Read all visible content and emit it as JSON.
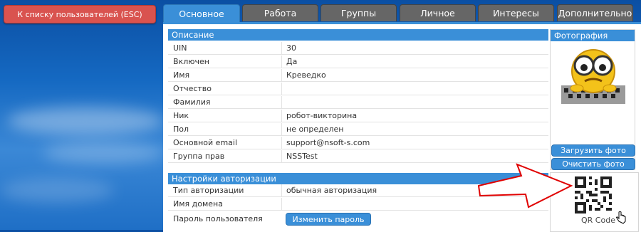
{
  "back_button": {
    "label": "К списку пользователей (ESC)"
  },
  "tabs": [
    {
      "label": "Основное",
      "active": true
    },
    {
      "label": "Работа",
      "active": false
    },
    {
      "label": "Группы",
      "active": false
    },
    {
      "label": "Личное",
      "active": false
    },
    {
      "label": "Интересы",
      "active": false
    },
    {
      "label": "Дополнительно",
      "active": false
    }
  ],
  "description": {
    "header": "Описание",
    "rows": [
      {
        "label": "UIN",
        "value": "30"
      },
      {
        "label": "Включен",
        "value": "Да"
      },
      {
        "label": "Имя",
        "value": "Креведко"
      },
      {
        "label": "Отчество",
        "value": ""
      },
      {
        "label": "Фамилия",
        "value": ""
      },
      {
        "label": "Ник",
        "value": "робот-викторина"
      },
      {
        "label": "Пол",
        "value": "не определен"
      },
      {
        "label": "Основной email",
        "value": "support@nsoft-s.com"
      },
      {
        "label": "Группа прав",
        "value": "NSSTest"
      }
    ]
  },
  "photo": {
    "header": "Фотография",
    "upload_label": "Загрузить фото",
    "clear_label": "Очистить фото"
  },
  "auth": {
    "header": "Настройки авторизации",
    "rows": [
      {
        "label": "Тип авторизации",
        "value": "обычная авторизация"
      },
      {
        "label": "Имя домена",
        "value": ""
      },
      {
        "label": "Пароль пользователя",
        "button": "Изменить пароль"
      }
    ]
  },
  "qr": {
    "label": "QR Code"
  },
  "colors": {
    "accent": "#3a8fd8",
    "back_button": "#d9534f",
    "tab_inactive": "#666666",
    "arrow": "#e00000"
  }
}
